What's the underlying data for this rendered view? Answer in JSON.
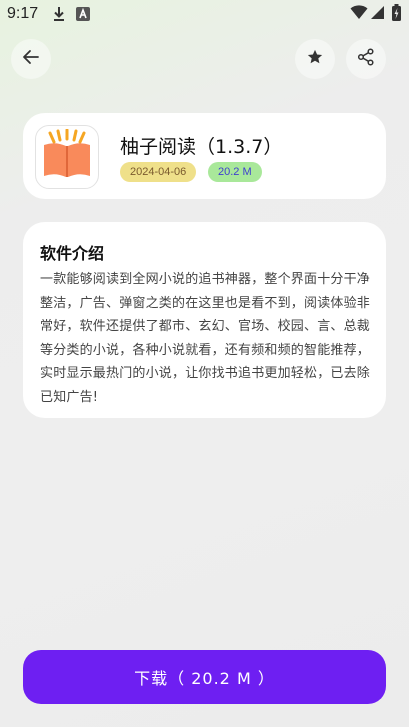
{
  "status_bar": {
    "time": "9:17",
    "icons": [
      "download-icon",
      "notification-a-icon",
      "wifi-icon",
      "signal-icon",
      "battery-charging-icon"
    ]
  },
  "toolbar": {
    "back_icon": "arrow-left-icon",
    "favorite_icon": "star-icon",
    "share_icon": "share-icon"
  },
  "app": {
    "name": "柚子阅读（1.3.7）",
    "date": "2024-04-06",
    "size": "20.2 M",
    "icon": "open-book-icon",
    "date_badge_color": "#efe08a",
    "size_badge_color": "#a9e89a"
  },
  "intro": {
    "title": "软件介绍",
    "body": "一款能够阅读到全网小说的追书神器，整个界面十分干净整洁，广告、弹窗之类的在这里也是看不到，阅读体验非常好，软件还提供了都市、玄幻、官场、校园、言、总裁等分类的小说，各种小说就看，还有频和频的智能推荐，实时显示最热门的小说，让你找书追书更加轻松，已去除已知广告!"
  },
  "download": {
    "label": "下载（ 20.2 M ）",
    "color": "#6e1ff2"
  }
}
